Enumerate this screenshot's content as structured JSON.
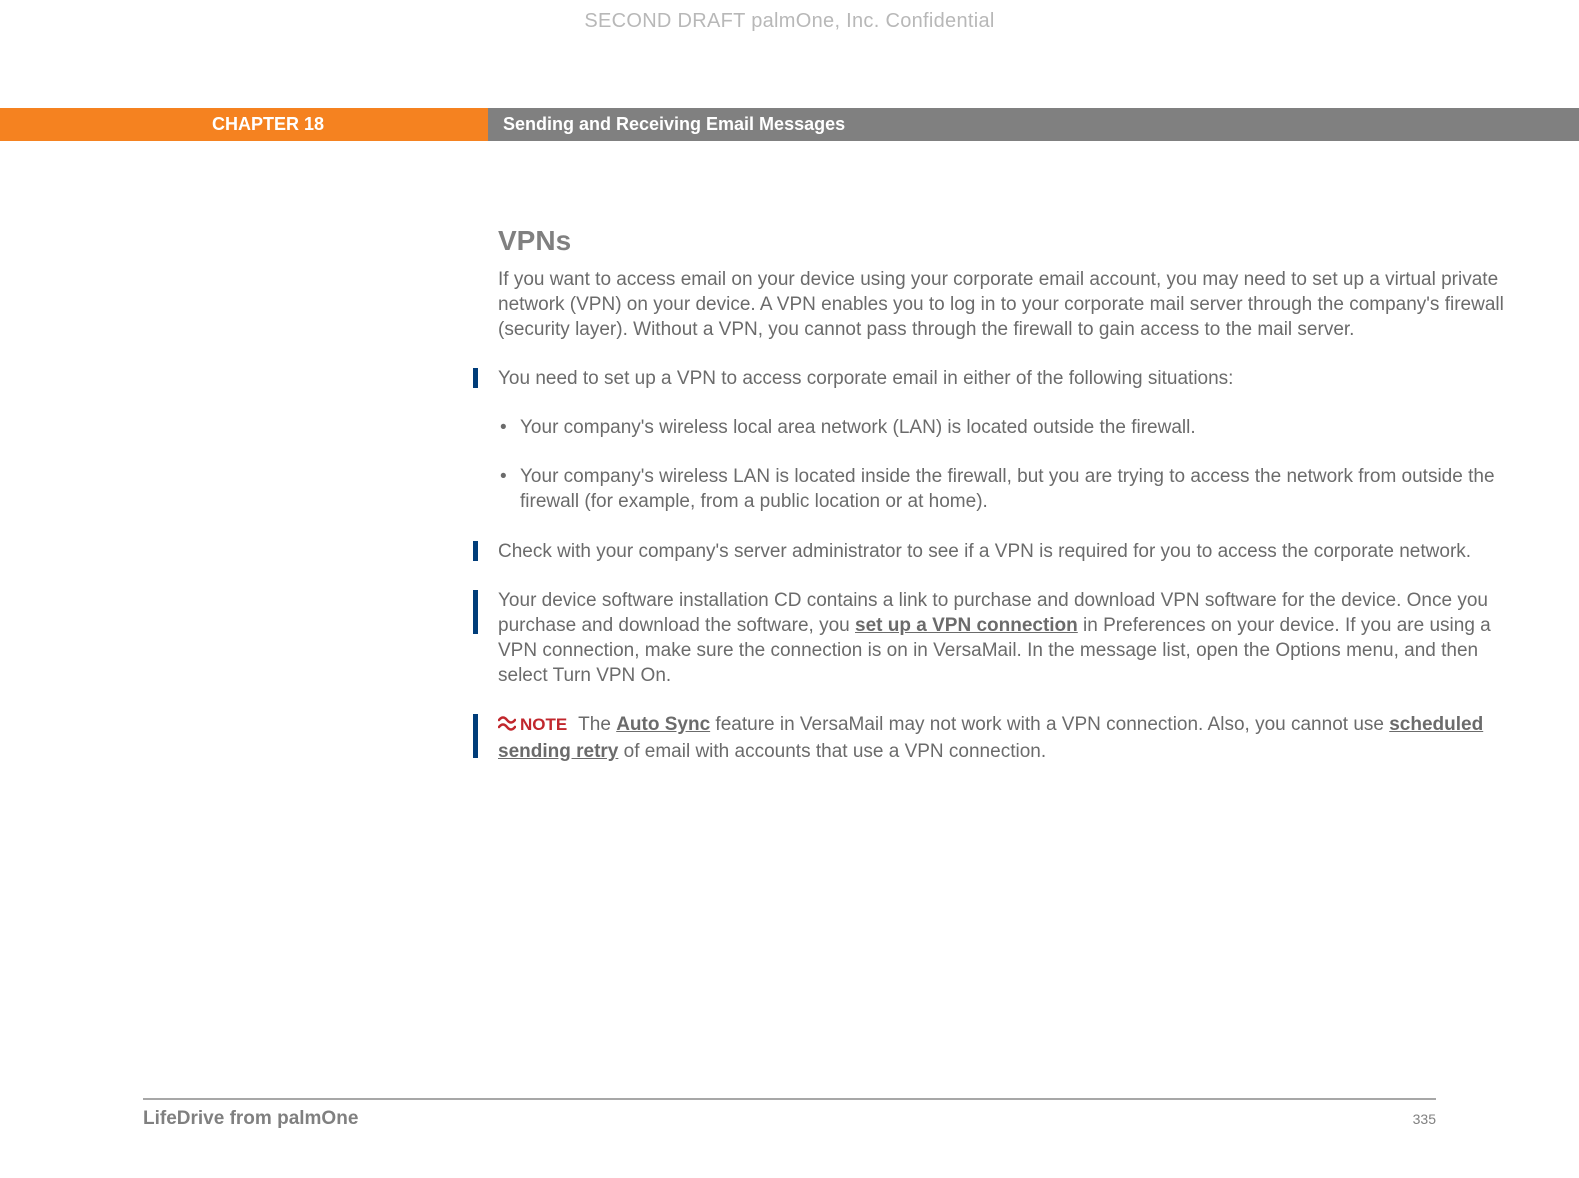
{
  "watermark": "SECOND DRAFT palmOne, Inc.  Confidential",
  "header": {
    "chapter": "CHAPTER 18",
    "title": "Sending and Receiving Email Messages"
  },
  "section": {
    "heading": "VPNs",
    "intro": "If you want to access email on your device using your corporate email account, you may need to set up a virtual private network (VPN) on your device. A VPN enables you to log in to your corporate mail server through the company's firewall (security layer). Without a VPN, you cannot pass through the firewall to gain access to the mail server.",
    "situations_lead": "You need to set up a VPN to access corporate email in either of the following situations:",
    "bullets": [
      "Your company's wireless local area network (LAN) is located outside the firewall.",
      "Your company's wireless LAN is located inside the firewall, but you are trying to access the network from outside the firewall (for example, from a public location or at home)."
    ],
    "check_admin": "Check with your company's server administrator to see if a VPN is required for you to access the corporate network.",
    "cd_para": {
      "pre": "Your device software installation CD contains a link to purchase and download VPN software for the device. Once you purchase and download the software, you ",
      "link": "set up a VPN connection",
      "post": " in Preferences on your device. If you are using a VPN connection, make sure the connection is on in VersaMail. In the message list, open the Options menu, and then select Turn VPN On."
    },
    "note": {
      "label": "NOTE",
      "pre": "The ",
      "link1": "Auto Sync",
      "mid": " feature in VersaMail may not work with a VPN connection. Also, you cannot use ",
      "link2": "scheduled sending retry",
      "post": " of email with accounts that use a VPN connection."
    }
  },
  "footer": {
    "product": "LifeDrive from palmOne",
    "page": "335"
  }
}
